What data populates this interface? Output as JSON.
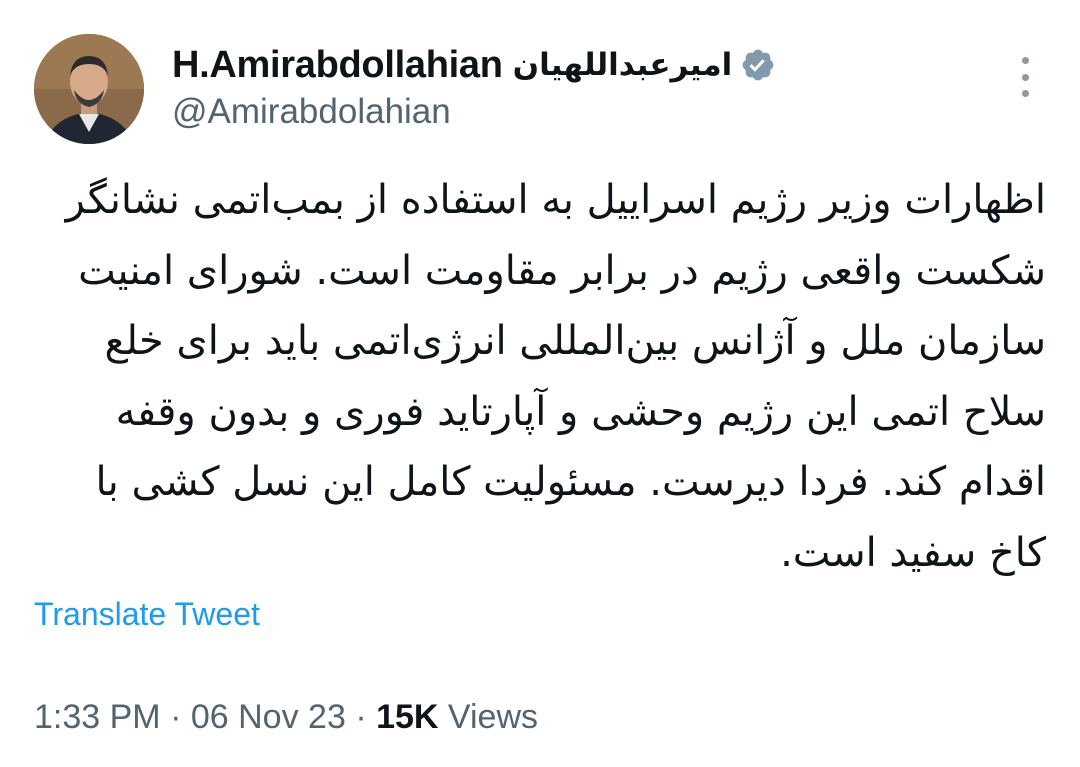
{
  "author": {
    "display_name": "H.Amirabdollahian",
    "display_name_fa": "امیرعبداللهیان",
    "handle": "@Amirabdolahian",
    "verified_icon": "verified-badge-icon",
    "verified_color": "#829aab"
  },
  "tweet": {
    "lines": [
      "اظهارات وزیر رژیم اسراییل به استفاده از بمب‌اتمی نشانگر",
      "شکست واقعی رژیم در برابر مقاومت است. شورای امنیت",
      "سازمان ملل و آژانس بین‌المللی انرژی‌اتمی باید برای خلع",
      "سلاح اتمی این رژیم وحشی و آپارتاید فوری و بدون وقفه",
      "اقدام کند. فردا دیرست. مسئولیت کامل این نسل کشی با",
      "کاخ سفید است."
    ],
    "translate_label": "Translate Tweet",
    "time": "1:33 PM",
    "separator": "·",
    "date": "06 Nov 23",
    "views_count": "15K",
    "views_label": "Views"
  },
  "colors": {
    "text": "#0f1419",
    "secondary": "#536471",
    "link": "#1d9bf0"
  },
  "icons": {
    "more": "more-vertical-icon"
  }
}
